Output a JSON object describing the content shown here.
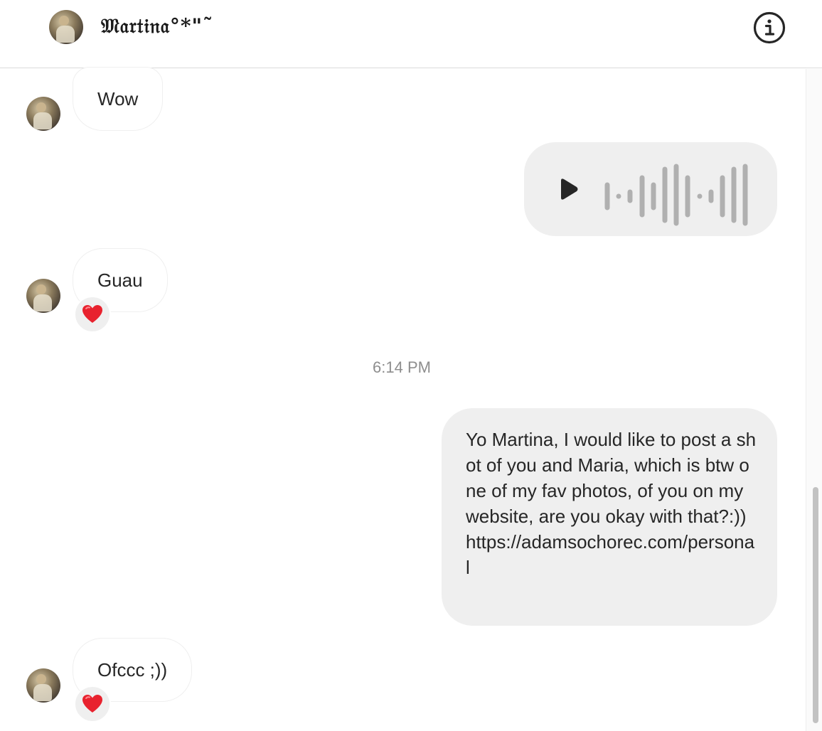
{
  "header": {
    "contact_name": "𝔐𝔞𝔯𝔱𝔦𝔫𝔞°*\"˜",
    "info_icon": "info-icon"
  },
  "messages": [
    {
      "direction": "incoming",
      "type": "text",
      "text": "Wow"
    },
    {
      "direction": "outgoing",
      "type": "voice",
      "play_icon": "play-icon"
    },
    {
      "direction": "incoming",
      "type": "text",
      "text": "Guau",
      "reaction": "❤️"
    },
    {
      "direction": "divider",
      "type": "timestamp",
      "text": "6:14 PM"
    },
    {
      "direction": "outgoing",
      "type": "text",
      "text": "Yo Martina, I would like to post a shot of you and Maria, which is btw one of my fav photos, of you on my website, are you okay with that?:)) https://adamsochorec.com/personal"
    },
    {
      "direction": "incoming",
      "type": "text",
      "text": "Ofccc ;))",
      "reaction": "❤️"
    }
  ],
  "colors": {
    "incoming_bubble_border": "#efefef",
    "outgoing_bubble_bg": "#efefef",
    "text": "#262626",
    "timestamp": "#8e8e8e",
    "waveform": "#b0b0b0"
  }
}
